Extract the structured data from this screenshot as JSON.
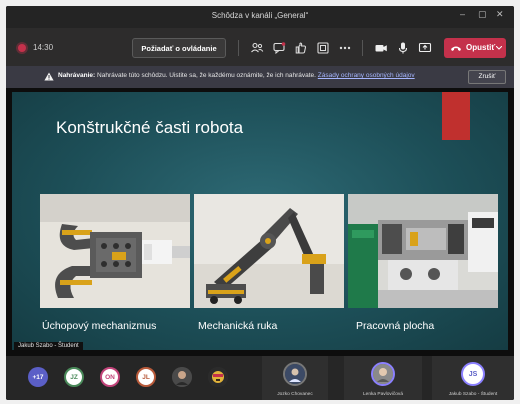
{
  "window": {
    "title": "Schôdza v kanáli „General“",
    "minimize_glyph": "–",
    "maximize_glyph": "▢",
    "close_glyph": "✕"
  },
  "toolbar": {
    "timer": "14:30",
    "ask_button_label": "Požiadať o ovládanie",
    "leave_label": "Opustiť",
    "icons": [
      "participants-icon",
      "chat-icon",
      "reactions-icon",
      "rooms-icon",
      "more-icon",
      "camera-icon",
      "microphone-icon",
      "share-icon",
      "chevron-down-icon"
    ]
  },
  "notice": {
    "title": "Nahrávanie:",
    "text": "Nahrávate túto schôdzu. Uistite sa, že každému oznámite, že ich nahrávate.",
    "link": "Zásady ochrany osobných údajov",
    "dismiss_label": "Zrušiť"
  },
  "slide": {
    "title": "Konštrukčné časti robota",
    "captions": [
      "Úchopový mechanizmus",
      "Mechanická ruka",
      "Pracovná plocha"
    ]
  },
  "presenter": {
    "label": "Jakub Szabo - Študent"
  },
  "participants": {
    "overflow": "+17",
    "avatars": [
      {
        "initials": "JZ",
        "color": "#4a8a5a"
      },
      {
        "initials": "ON",
        "color": "#c2447a"
      },
      {
        "initials": "JL",
        "color": "#b85a3a"
      },
      {
        "initials": "",
        "color": "#555555"
      },
      {
        "initials": "",
        "color": "#555555"
      }
    ],
    "tiles": [
      {
        "name": "Jozko Chovanec",
        "initials": "",
        "ring": "#777777"
      },
      {
        "name": "Lenka Pavlovičová",
        "initials": "",
        "ring": "#8b80ff"
      },
      {
        "name": "Jakub Szabo - Študent",
        "initials": "JS",
        "ring": "#8b80ff"
      }
    ]
  },
  "colors": {
    "accent_red": "#c4314b",
    "slide_bg": "#1d4f58",
    "slide_accent": "#c0302e"
  }
}
